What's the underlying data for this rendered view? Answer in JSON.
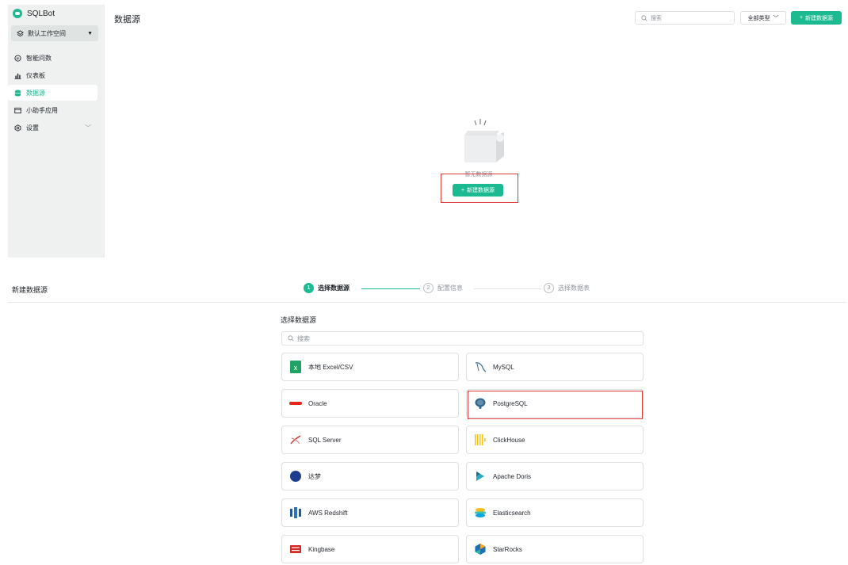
{
  "app": {
    "brand": "SQLBot",
    "workspace": "默认工作空间",
    "nav": [
      {
        "label": "智能问数",
        "icon": "chat-icon",
        "active": false
      },
      {
        "label": "仪表板",
        "icon": "dashboard-icon",
        "active": false
      },
      {
        "label": "数据源",
        "icon": "database-icon",
        "active": true
      },
      {
        "label": "小助手应用",
        "icon": "assistant-icon",
        "active": false
      },
      {
        "label": "设置",
        "icon": "settings-icon",
        "active": false
      }
    ],
    "page_title": "数据源",
    "search_placeholder": "搜索",
    "type_filter": "全部类型",
    "new_button": "新建数据源",
    "empty_text": "暂无数据源",
    "empty_button": "新建数据源"
  },
  "wizard": {
    "title": "新建数据源",
    "steps": [
      {
        "num": "1",
        "label": "选择数据源"
      },
      {
        "num": "2",
        "label": "配置信息"
      },
      {
        "num": "3",
        "label": "选择数据表"
      }
    ],
    "section_label": "选择数据源",
    "search_placeholder": "搜索",
    "datasources": [
      {
        "label": "本地 Excel/CSV",
        "icon": "excel-icon"
      },
      {
        "label": "MySQL",
        "icon": "mysql-icon"
      },
      {
        "label": "Oracle",
        "icon": "oracle-icon"
      },
      {
        "label": "PostgreSQL",
        "icon": "postgresql-icon"
      },
      {
        "label": "SQL Server",
        "icon": "sqlserver-icon"
      },
      {
        "label": "ClickHouse",
        "icon": "clickhouse-icon"
      },
      {
        "label": "达梦",
        "icon": "dameng-icon"
      },
      {
        "label": "Apache Doris",
        "icon": "doris-icon"
      },
      {
        "label": "AWS Redshift",
        "icon": "redshift-icon"
      },
      {
        "label": "Elasticsearch",
        "icon": "elasticsearch-icon"
      },
      {
        "label": "Kingbase",
        "icon": "kingbase-icon"
      },
      {
        "label": "StarRocks",
        "icon": "starrocks-icon"
      }
    ]
  },
  "colors": {
    "accent": "#1cba90",
    "highlight": "#e03a3a"
  }
}
